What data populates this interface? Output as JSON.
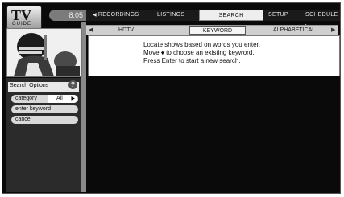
{
  "logo": {
    "text_big": "TV",
    "text_small": "GUIDE"
  },
  "clock": "8:05",
  "top_tabs": [
    {
      "label": "RECORDINGS",
      "selected": false
    },
    {
      "label": "LISTINGS",
      "selected": false
    },
    {
      "label": "SEARCH",
      "selected": true
    },
    {
      "label": "SETUP",
      "selected": false
    },
    {
      "label": "SCHEDULE",
      "selected": false
    }
  ],
  "sub_tabs": [
    {
      "label": "HDTV",
      "selected": false
    },
    {
      "label": "KEYWORD",
      "selected": true
    },
    {
      "label": "ALPHABETICAL",
      "selected": false
    }
  ],
  "message": [
    "Locate shows based on words you enter.",
    "Move ♦ to choose an existing keyword.",
    "Press Enter to start a new search."
  ],
  "panel": {
    "title": "Search Options",
    "help": "?",
    "category_label": "category",
    "category_value": "All",
    "enter_keyword": "enter keyword",
    "cancel": "cancel"
  }
}
